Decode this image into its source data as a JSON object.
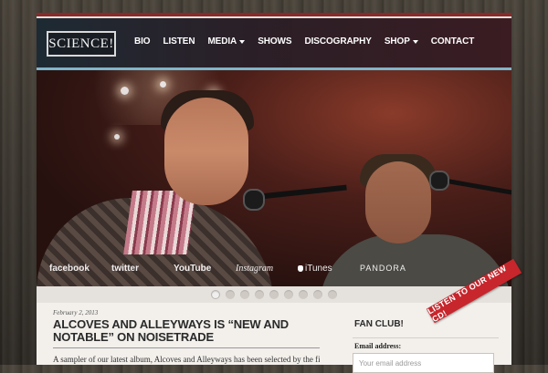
{
  "site": {
    "logo_text": "SCIENCE!"
  },
  "nav": {
    "items": [
      {
        "label": "BIO",
        "has_dropdown": false
      },
      {
        "label": "LISTEN",
        "has_dropdown": false
      },
      {
        "label": "MEDIA",
        "has_dropdown": true
      },
      {
        "label": "SHOWS",
        "has_dropdown": false
      },
      {
        "label": "DISCOGRAPHY",
        "has_dropdown": false
      },
      {
        "label": "SHOP",
        "has_dropdown": true
      },
      {
        "label": "CONTACT",
        "has_dropdown": false
      }
    ]
  },
  "hero": {
    "socials": [
      "facebook",
      "twitter",
      "YouTube",
      "Instagram",
      "iTunes",
      "PANDORA"
    ],
    "slide_count": 9,
    "active_slide": 1,
    "ribbon_text": "LISTEN TO OUR NEW CD!"
  },
  "post": {
    "date": "February 2, 2013",
    "title": "ALCOVES AND ALLEYWAYS IS “NEW AND NOTABLE” ON NOISETRADE",
    "excerpt": "A sampler of our latest album, Alcoves and Alleyways has been selected by the fine"
  },
  "sidebar": {
    "fan_club_title": "FAN CLUB!",
    "email_label": "Email address:",
    "email_placeholder": "Your email address"
  },
  "colors": {
    "accent_red": "#c7262c",
    "header_dark": "#1e2a33",
    "header_underline": "#7fb5c9",
    "page_bg": "#f3f0ec"
  }
}
